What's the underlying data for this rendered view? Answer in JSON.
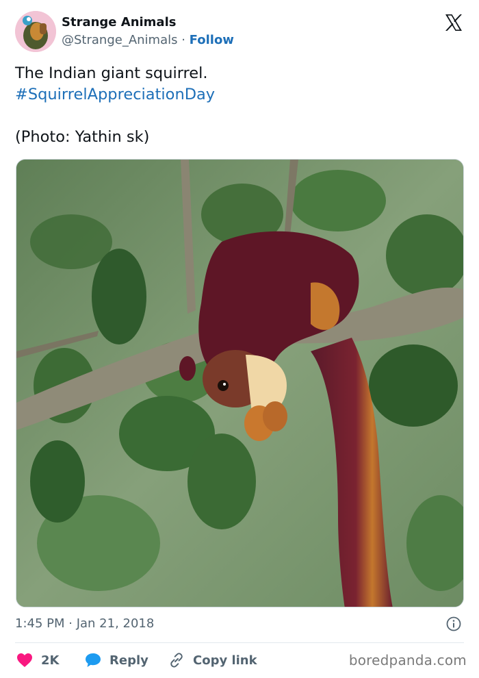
{
  "author": {
    "name": "Strange Animals",
    "handle": "@Strange_Animals",
    "separator": " · ",
    "follow_label": "Follow"
  },
  "tweet": {
    "line1": "The Indian giant squirrel.",
    "hashtag": "#SquirrelAppreciationDay",
    "credit": "(Photo: Yathin sk)"
  },
  "meta": {
    "time": "1:45 PM",
    "separator": " · ",
    "date": "Jan 21, 2018"
  },
  "actions": {
    "likes": "2K",
    "reply_label": "Reply",
    "copy_label": "Copy link"
  },
  "watermark": "boredpanda.com",
  "icons": {
    "brand": "x-logo-icon",
    "info": "info-icon",
    "like": "heart-icon",
    "reply": "speech-bubble-icon",
    "copy": "link-icon"
  },
  "colors": {
    "link": "#1d6fb8",
    "heart": "#f91880",
    "reply": "#1d9bf0",
    "muted": "#536471"
  }
}
